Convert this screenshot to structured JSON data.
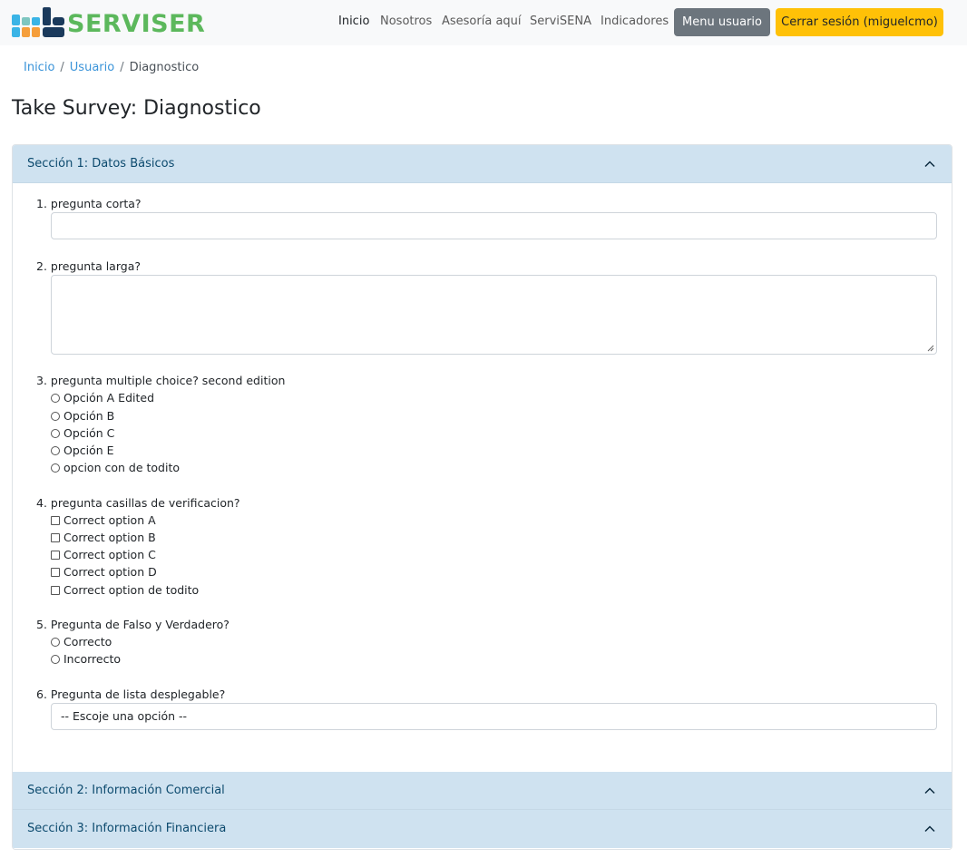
{
  "brand": {
    "name": "SERVISER",
    "colors": {
      "green": "#5cb85c",
      "navy": "#1b3a5c",
      "cyan": "#3ab4e6",
      "orange": "#f59e3b",
      "teal": "#7ec6c0",
      "accordion": "#cfe2f0"
    }
  },
  "nav": {
    "links": [
      "Inicio",
      "Nosotros",
      "Asesoría aquí",
      "ServiSENA",
      "Indicadores"
    ],
    "menu_button": "Menu usuario",
    "logout_button": "Cerrar sesión (miguelcmo)"
  },
  "breadcrumb": {
    "items": [
      "Inicio",
      "Usuario"
    ],
    "current": "Diagnostico",
    "separator": "/"
  },
  "page_title": "Take Survey: Diagnostico",
  "sections": [
    {
      "label": "Sección 1: Datos Básicos",
      "icon": "chevron-up-icon"
    },
    {
      "label": "Sección 2: Información Comercial",
      "icon": "chevron-up-icon"
    },
    {
      "label": "Sección 3: Información Financiera",
      "icon": "chevron-up-icon"
    }
  ],
  "questions": [
    {
      "label": "1. pregunta corta?"
    },
    {
      "label": "2. pregunta larga?"
    },
    {
      "label": "3. pregunta multiple choice? second edition",
      "options": [
        "Opción A Edited",
        "Opción B",
        "Opción C",
        "Opción E",
        "opcion con de todito"
      ]
    },
    {
      "label": "4. pregunta casillas de verificacion?",
      "options": [
        "Correct option A",
        "Correct option B",
        "Correct option C",
        "Correct option D",
        "Correct option de todito"
      ]
    },
    {
      "label": "5. Pregunta de Falso y Verdadero?",
      "options": [
        "Correcto",
        "Incorrecto"
      ]
    },
    {
      "label": "6. Pregunta de lista desplegable?",
      "select_value": "-- Escoje una opción --"
    }
  ]
}
